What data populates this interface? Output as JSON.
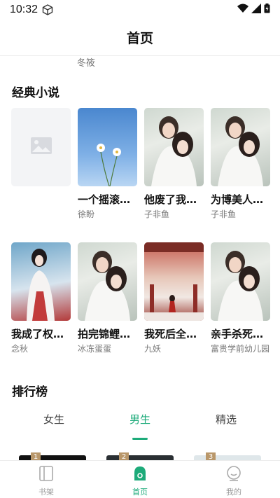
{
  "status_bar": {
    "time": "10:32"
  },
  "header": {
    "title": "首页"
  },
  "peek": {
    "author": "冬筱"
  },
  "classic_section": {
    "title": "经典小说",
    "books": [
      {
        "title": "",
        "author": "",
        "cover": "placeholder"
      },
      {
        "title": "一个摇滚…",
        "author": "徐盼",
        "cover": "sky"
      },
      {
        "title": "他废了我…",
        "author": "子非鱼",
        "cover": "couple"
      },
      {
        "title": "为博美人…",
        "author": "子非鱼",
        "cover": "couple"
      },
      {
        "title": "我成了权…",
        "author": "念秋",
        "cover": "hanfu"
      },
      {
        "title": "拍完锦鲤…",
        "author": "冰冻蛋蛋",
        "cover": "couple"
      },
      {
        "title": "我死后全…",
        "author": "九妖",
        "cover": "palace"
      },
      {
        "title": "亲手杀死…",
        "author": "富贵学前幼儿园",
        "cover": "couple"
      }
    ]
  },
  "ranking_section": {
    "title": "排行榜",
    "tabs": [
      {
        "label": "女生",
        "active": false
      },
      {
        "label": "男生",
        "active": true
      },
      {
        "label": "精选",
        "active": false
      }
    ],
    "ranks": [
      "1",
      "2",
      "3"
    ]
  },
  "bottom_nav": {
    "items": [
      {
        "label": "书架",
        "icon": "bookshelf-icon",
        "active": false
      },
      {
        "label": "首页",
        "icon": "home-icon",
        "active": true
      },
      {
        "label": "我的",
        "icon": "profile-icon",
        "active": false
      }
    ]
  },
  "colors": {
    "accent": "#1dab7a",
    "rank_badge": "#b9976a"
  }
}
